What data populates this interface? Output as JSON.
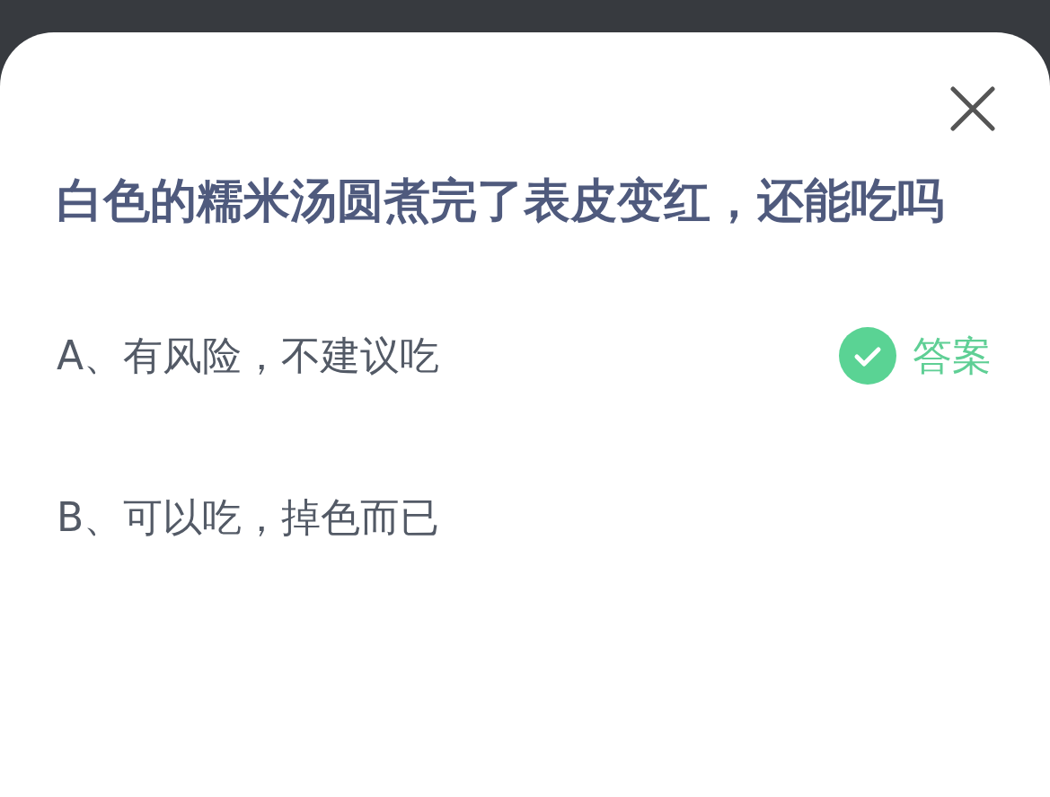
{
  "question": "白色的糯米汤圆煮完了表皮变红，还能吃吗",
  "options": [
    {
      "text": "A、有风险，不建议吃",
      "correct": true
    },
    {
      "text": "B、可以吃，掉色而已",
      "correct": false
    }
  ],
  "answer_label": "答案"
}
